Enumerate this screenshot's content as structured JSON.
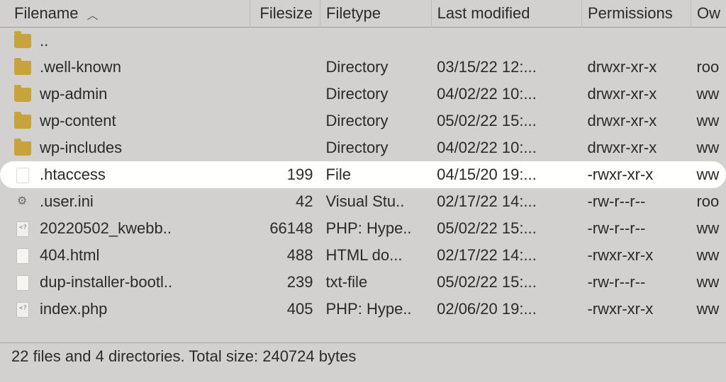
{
  "columns": {
    "filename": "Filename",
    "filesize": "Filesize",
    "filetype": "Filetype",
    "last_modified": "Last modified",
    "permissions": "Permissions",
    "owner": "Ow"
  },
  "sort": {
    "column": "filename",
    "direction": "asc"
  },
  "rows": [
    {
      "icon": "folder",
      "name": "..",
      "size": "",
      "type": "",
      "modified": "",
      "perms": "",
      "owner": "",
      "highlight": false
    },
    {
      "icon": "folder",
      "name": ".well-known",
      "size": "",
      "type": "Directory",
      "modified": "03/15/22 12:...",
      "perms": "drwxr-xr-x",
      "owner": "roo",
      "highlight": false
    },
    {
      "icon": "folder",
      "name": "wp-admin",
      "size": "",
      "type": "Directory",
      "modified": "04/02/22 10:...",
      "perms": "drwxr-xr-x",
      "owner": "ww",
      "highlight": false
    },
    {
      "icon": "folder",
      "name": "wp-content",
      "size": "",
      "type": "Directory",
      "modified": "05/02/22 15:...",
      "perms": "drwxr-xr-x",
      "owner": "ww",
      "highlight": false
    },
    {
      "icon": "folder",
      "name": "wp-includes",
      "size": "",
      "type": "Directory",
      "modified": "04/02/22 10:...",
      "perms": "drwxr-xr-x",
      "owner": "ww",
      "highlight": false
    },
    {
      "icon": "file-highlight",
      "name": ".htaccess",
      "size": "199",
      "type": "File",
      "modified": "04/15/20 19:...",
      "perms": "-rwxr-xr-x",
      "owner": "ww",
      "highlight": true
    },
    {
      "icon": "gear",
      "name": ".user.ini",
      "size": "42",
      "type": "Visual Stu..",
      "modified": "02/17/22 14:...",
      "perms": "-rw-r--r--",
      "owner": "roo",
      "highlight": false
    },
    {
      "icon": "php",
      "name": "20220502_kwebb..",
      "size": "66148",
      "type": "PHP: Hype..",
      "modified": "05/02/22 15:...",
      "perms": "-rw-r--r--",
      "owner": "ww",
      "highlight": false
    },
    {
      "icon": "file",
      "name": "404.html",
      "size": "488",
      "type": "HTML do...",
      "modified": "02/17/22 14:...",
      "perms": "-rwxr-xr-x",
      "owner": "ww",
      "highlight": false
    },
    {
      "icon": "file",
      "name": "dup-installer-bootl..",
      "size": "239",
      "type": "txt-file",
      "modified": "05/02/22 15:...",
      "perms": "-rw-r--r--",
      "owner": "ww",
      "highlight": false
    },
    {
      "icon": "php",
      "name": "index.php",
      "size": "405",
      "type": "PHP: Hype..",
      "modified": "02/06/20 19:...",
      "perms": "-rwxr-xr-x",
      "owner": "ww",
      "highlight": false
    }
  ],
  "status": "22 files and 4 directories. Total size: 240724 bytes"
}
